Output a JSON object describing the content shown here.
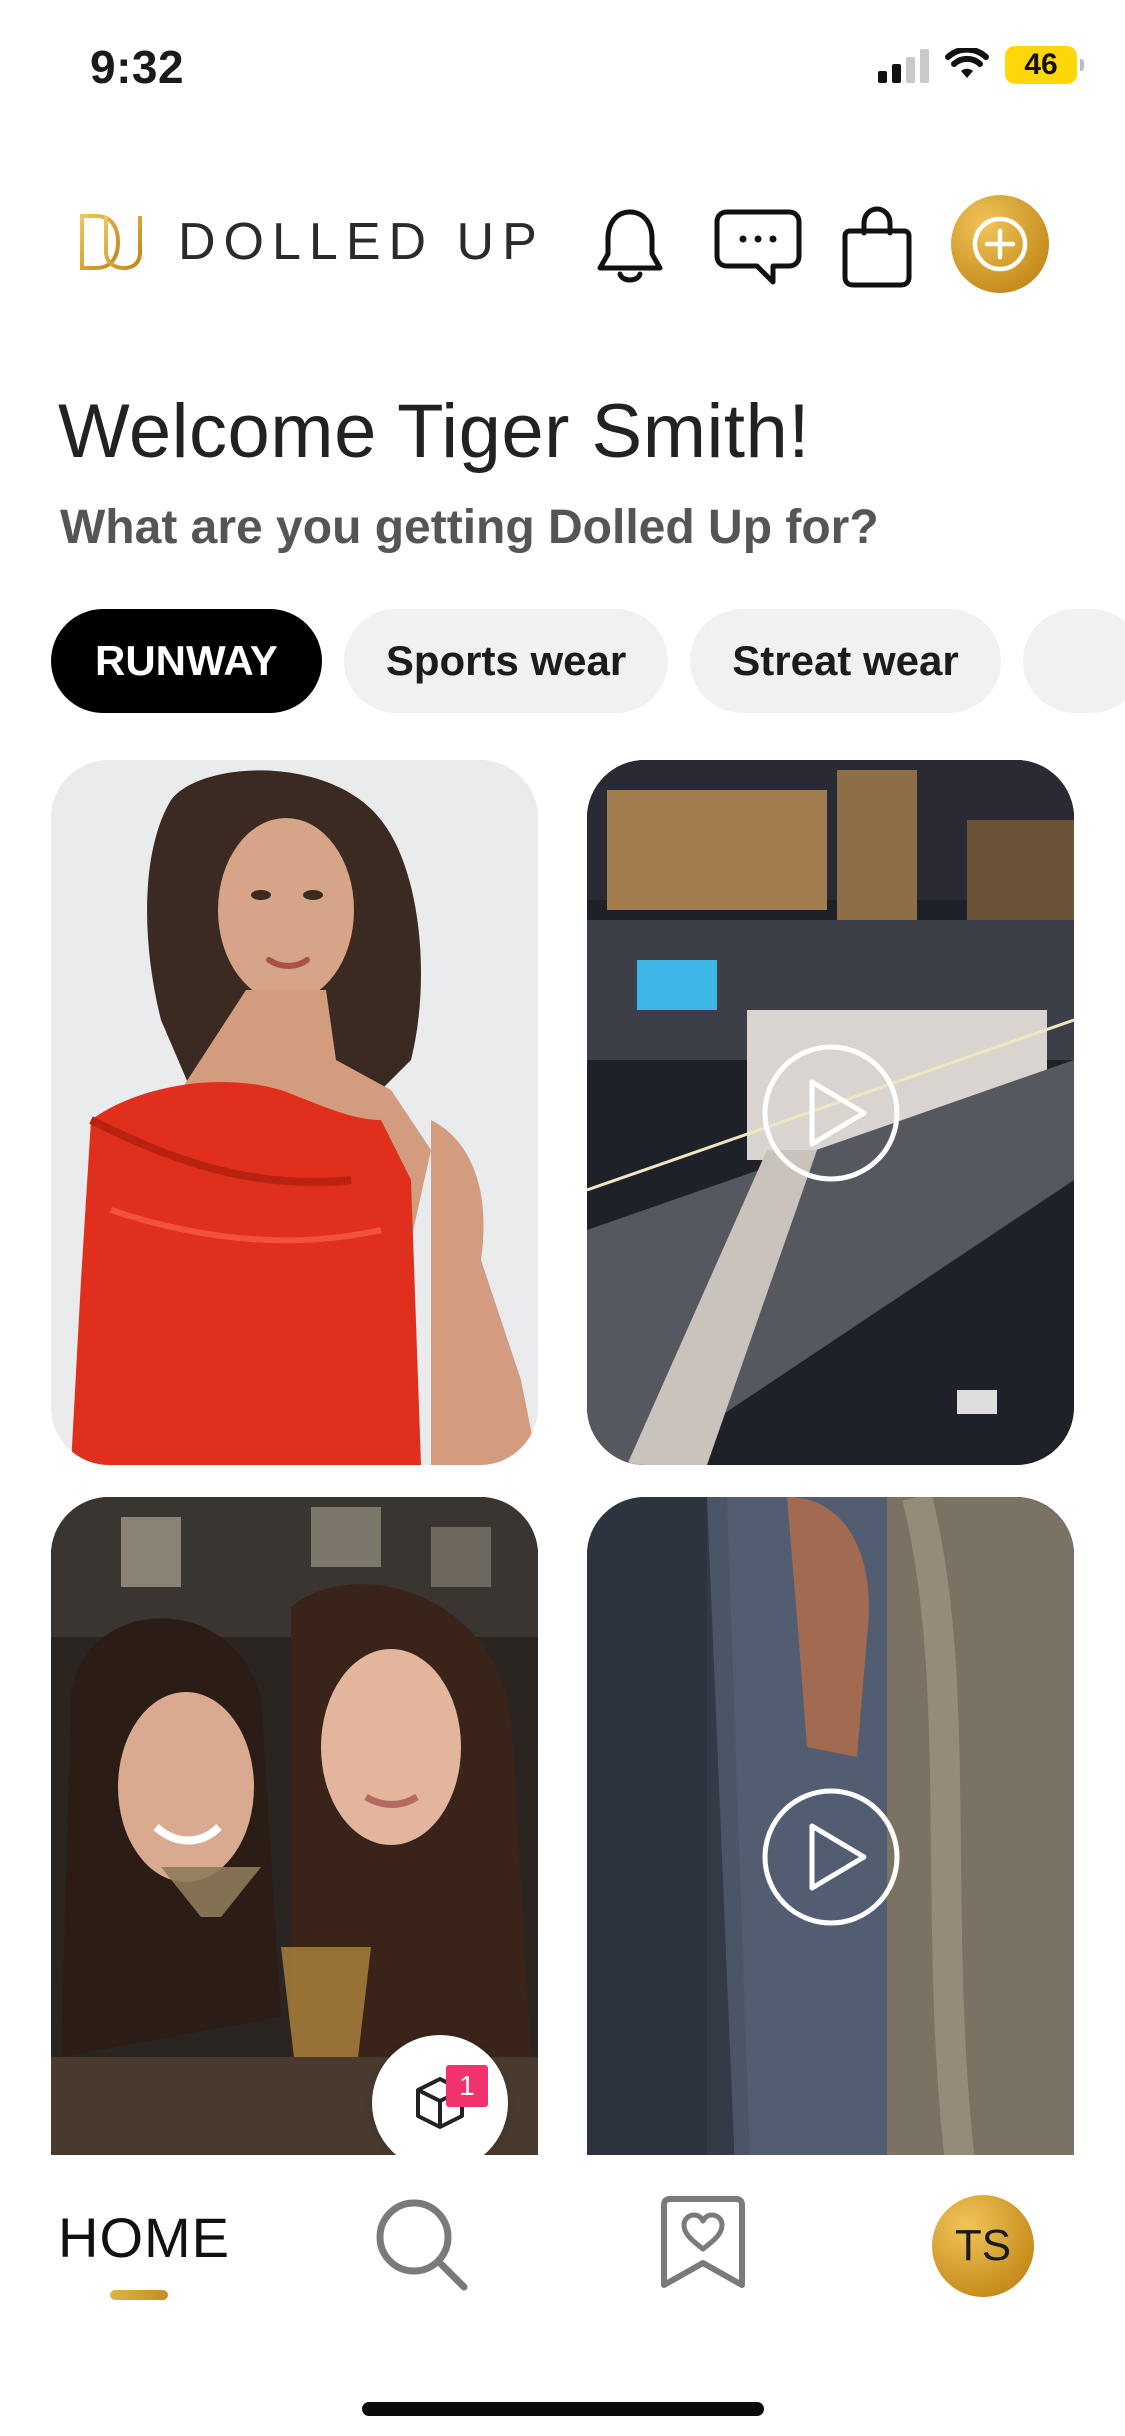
{
  "status_bar": {
    "time": "9:32",
    "battery": "46",
    "battery_color": "#ffd60a"
  },
  "header": {
    "brand": "DOLLED UP",
    "icons": [
      "bell-icon",
      "chat-icon",
      "bag-icon",
      "add-icon"
    ],
    "accent": "#d9a63a"
  },
  "welcome": {
    "title": "Welcome Tiger Smith!",
    "subtitle": "What are you getting Dolled Up for?"
  },
  "chips": [
    {
      "label": "RUNWAY",
      "active": true
    },
    {
      "label": "Sports wear",
      "active": false
    },
    {
      "label": "Streat wear",
      "active": false
    },
    {
      "label": "",
      "active": false
    }
  ],
  "feed": [
    {
      "type": "photo",
      "subject": "woman in red one-shoulder dress"
    },
    {
      "type": "video",
      "subject": "night aerial view of city race track"
    },
    {
      "type": "photo",
      "subject": "two women holding cocktails"
    },
    {
      "type": "video",
      "subject": "close-up of hand near patterned fabric"
    }
  ],
  "fab": {
    "icon": "cube-icon",
    "badge": "1",
    "badge_color": "#f2316f"
  },
  "bottom_nav": {
    "home_label": "HOME",
    "search_icon": "search-icon",
    "saved_icon": "heart-bookmark-icon",
    "avatar_initials": "TS"
  }
}
